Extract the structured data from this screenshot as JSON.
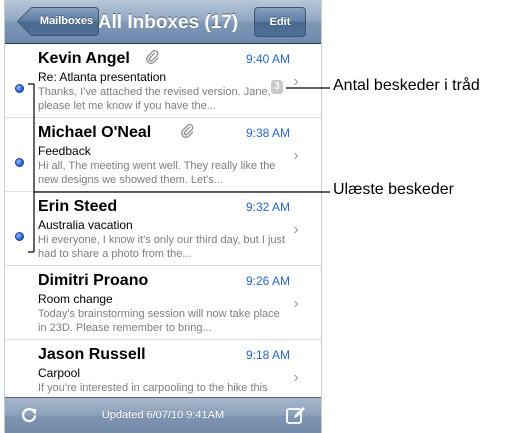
{
  "nav": {
    "back_label": "Mailboxes",
    "title": "All Inboxes (17)",
    "edit_label": "Edit"
  },
  "messages": [
    {
      "sender": "Kevin Angel",
      "time": "9:40 AM",
      "subject": "Re: Atlanta presentation",
      "preview": "Thanks, I've attached the revised version. Jane, please let me know if you have the...",
      "thread_count": "3",
      "unread": true,
      "has_attachment": true
    },
    {
      "sender": "Michael O'Neal",
      "time": "9:38 AM",
      "subject": "Feedback",
      "preview": "Hi all, The meeting went well. They really like the new designs we showed them. Let's...",
      "unread": true,
      "has_attachment": true
    },
    {
      "sender": "Erin Steed",
      "time": "9:32 AM",
      "subject": "Australia vacation",
      "preview": "Hi everyone, I know it's only our third day, but I just had to share a photo from the...",
      "unread": true,
      "has_attachment": false
    },
    {
      "sender": "Dimitri Proano",
      "time": "9:26 AM",
      "subject": "Room change",
      "preview": "Today's brainstorming session will now take place in 23D. Please remember to bring...",
      "unread": false,
      "has_attachment": false
    },
    {
      "sender": "Jason Russell",
      "time": "9:18 AM",
      "subject": "Carpool",
      "preview": "If you're interested in carpooling to the hike this weekend, let me know...",
      "unread": false,
      "has_attachment": false
    }
  ],
  "toolbar": {
    "status": "Updated 6/07/10 9:41AM"
  },
  "annotations": {
    "thread_count_label": "Antal beskeder i tråd",
    "unread_label": "Ulæste beskeder"
  },
  "colors": {
    "accent_blue": "#2a63c9",
    "navbar": "#7f99b7"
  },
  "icons": {
    "attachment": "paperclip-icon",
    "refresh": "refresh-icon",
    "compose": "compose-icon",
    "chevron": "chevron-right-icon"
  }
}
